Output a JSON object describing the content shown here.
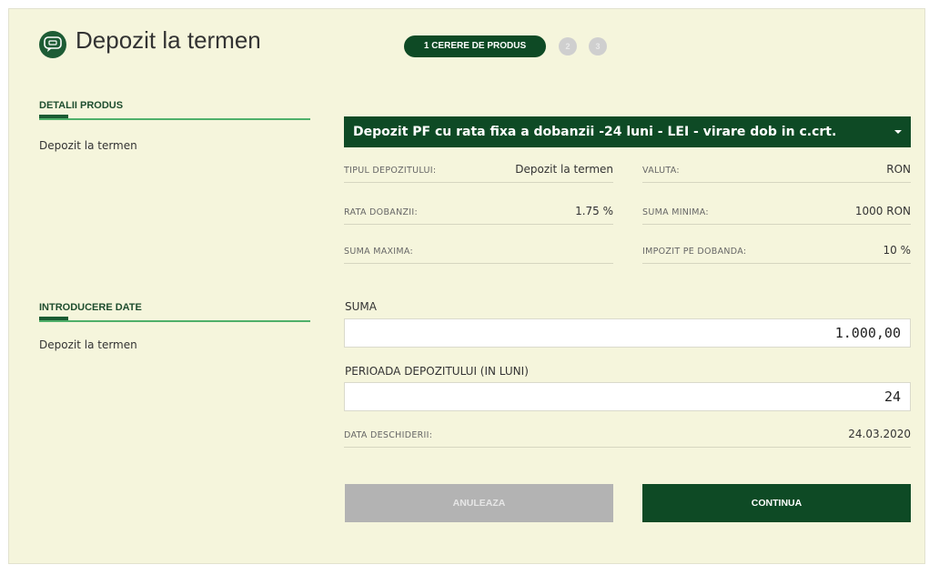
{
  "header": {
    "title": "Depozit la termen",
    "logo_icon": "chat-bubble-icon",
    "brand_color": "#0e4a25"
  },
  "stepper": {
    "active_label": "1 CERERE DE PRODUS",
    "step2": "2",
    "step3": "3"
  },
  "left": {
    "section1_title": "DETALII PRODUS",
    "section1_text": "Depozit la termen",
    "section2_title": "INTRODUCERE DATE",
    "section2_text": "Depozit la termen"
  },
  "product": {
    "selected": "Depozit PF cu rata fixa a dobanzii -24 luni - LEI - virare dob in c.crt."
  },
  "details": [
    {
      "label": "TIPUL DEPOZITULUI:",
      "value": "Depozit la termen"
    },
    {
      "label": "VALUTA:",
      "value": "RON"
    },
    {
      "label": "RATA DOBANZII:",
      "value": "1.75 %"
    },
    {
      "label": "SUMA MINIMA:",
      "value": "1000 RON"
    },
    {
      "label": "SUMA MAXIMA:",
      "value": ""
    },
    {
      "label": "IMPOZIT PE DOBANDA:",
      "value": "10 %"
    }
  ],
  "form": {
    "amount_label": "SUMA",
    "amount_value": "1.000,00",
    "period_label": "PERIOADA DEPOZITULUI (IN LUNI)",
    "period_value": "24",
    "open_date_label": "DATA DESCHIDERII:",
    "open_date_value": "24.03.2020"
  },
  "buttons": {
    "cancel": "ANULEAZA",
    "continue": "CONTINUA"
  }
}
